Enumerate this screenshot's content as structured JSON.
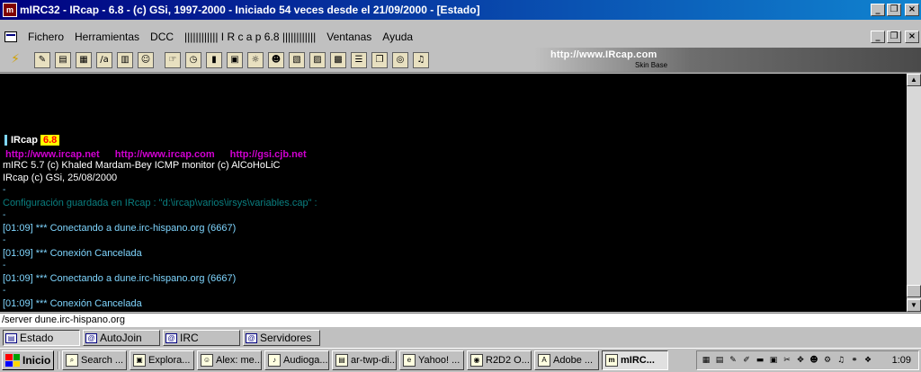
{
  "window": {
    "title": "mIRC32 - IRcap - 6.8 - (c) GSi, 1997-2000 - Iniciado 54 veces desde el 21/09/2000 - [Estado]"
  },
  "menu": {
    "items": [
      "Fichero",
      "Herramientas",
      "DCC",
      "|||||||||||| I R c a p 6.8 ||||||||||||",
      "Ventanas",
      "Ayuda"
    ]
  },
  "toolbar": {
    "skin_logo": "http://www.IRcap.com",
    "skin_label": "Skin Base"
  },
  "chat": {
    "logo_name": "IRcap",
    "logo_version": "6.8",
    "links": [
      "http://www.ircap.net",
      "http://www.ircap.com",
      "http://gsi.cjb.net"
    ],
    "line_mirc": "mIRC 5.7 (c) Khaled Mardam-Bey  ICMP monitor (c) AlCoHoLiC",
    "line_ircap": "IRcap (c) GSi, 25/08/2000",
    "line_config": "Configuración guardada en IRcap : \"d:\\ircap\\varios\\irsys\\variables.cap\" :",
    "separator": "-",
    "messages": [
      "[01:09] *** Conectando a dune.irc-hispano.org (6667)",
      "[01:09] *** Conexión Cancelada",
      "[01:09] *** Conectando a dune.irc-hispano.org (6667)",
      "[01:09] *** Conexión Cancelada"
    ]
  },
  "input": {
    "value": "/server dune.irc-hispano.org"
  },
  "switchbar": {
    "buttons": [
      "Estado",
      "AutoJoin",
      "IRC",
      "Servidores"
    ]
  },
  "taskbar": {
    "start_label": "Inicio",
    "tasks": [
      "Search ...",
      "Explora...",
      "Alex: me...",
      "Audioga...",
      "ar-twp-di...",
      "Yahoo! ...",
      "R2D2 O...",
      "Adobe ...",
      "mIRC..."
    ],
    "clock": "1:09"
  }
}
